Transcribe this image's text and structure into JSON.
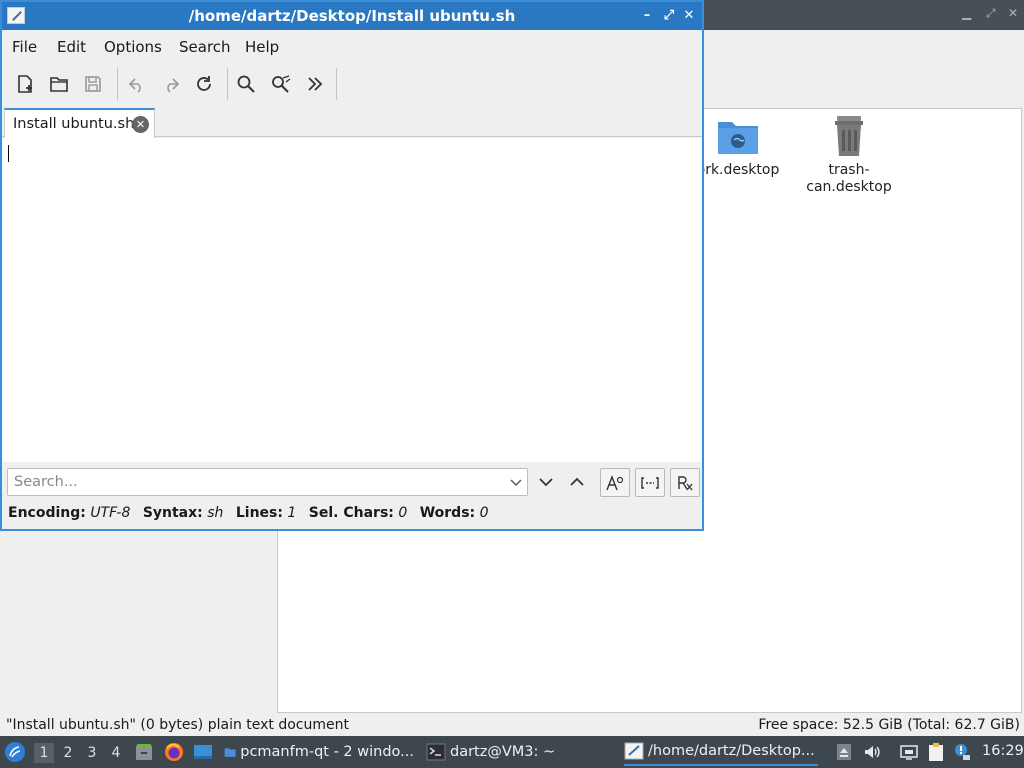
{
  "file_manager": {
    "icons": [
      {
        "label": "ork.desktop"
      },
      {
        "label": "trash-can.desktop"
      }
    ],
    "status_left": "\"Install ubuntu.sh\" (0 bytes) plain text document",
    "status_right": "Free space: 52.5 GiB (Total: 62.7 GiB)"
  },
  "editor": {
    "title": "/home/dartz/Desktop/Install ubuntu.sh",
    "menu": [
      "File",
      "Edit",
      "Options",
      "Search",
      "Help"
    ],
    "toolbar_icons": [
      "new-document-icon",
      "open-folder-icon",
      "save-icon",
      "undo-icon",
      "redo-icon",
      "reload-icon",
      "find-icon",
      "replace-icon",
      "more-icon"
    ],
    "tab_label": "Install ubuntu.sh",
    "search": {
      "placeholder": "Search...",
      "value": ""
    },
    "status": {
      "encoding_label": "Encoding:",
      "encoding": "UTF-8",
      "syntax_label": "Syntax:",
      "syntax": "sh",
      "lines_label": "Lines:",
      "lines": "1",
      "sel_label": "Sel. Chars:",
      "sel": "0",
      "words_label": "Words:",
      "words": "0"
    }
  },
  "taskbar": {
    "workspaces": [
      "1",
      "2",
      "3",
      "4"
    ],
    "active_workspace": "1",
    "tasks": [
      {
        "label": "pcmanfm-qt - 2 windo..."
      },
      {
        "label": "dartz@VM3: ~"
      },
      {
        "label": "/home/dartz/Desktop..."
      }
    ],
    "clock": "16:29"
  },
  "colors": {
    "accent": "#3b8fd9",
    "titlebar_active": "#2a78c2",
    "taskbar": "#3f474e"
  }
}
